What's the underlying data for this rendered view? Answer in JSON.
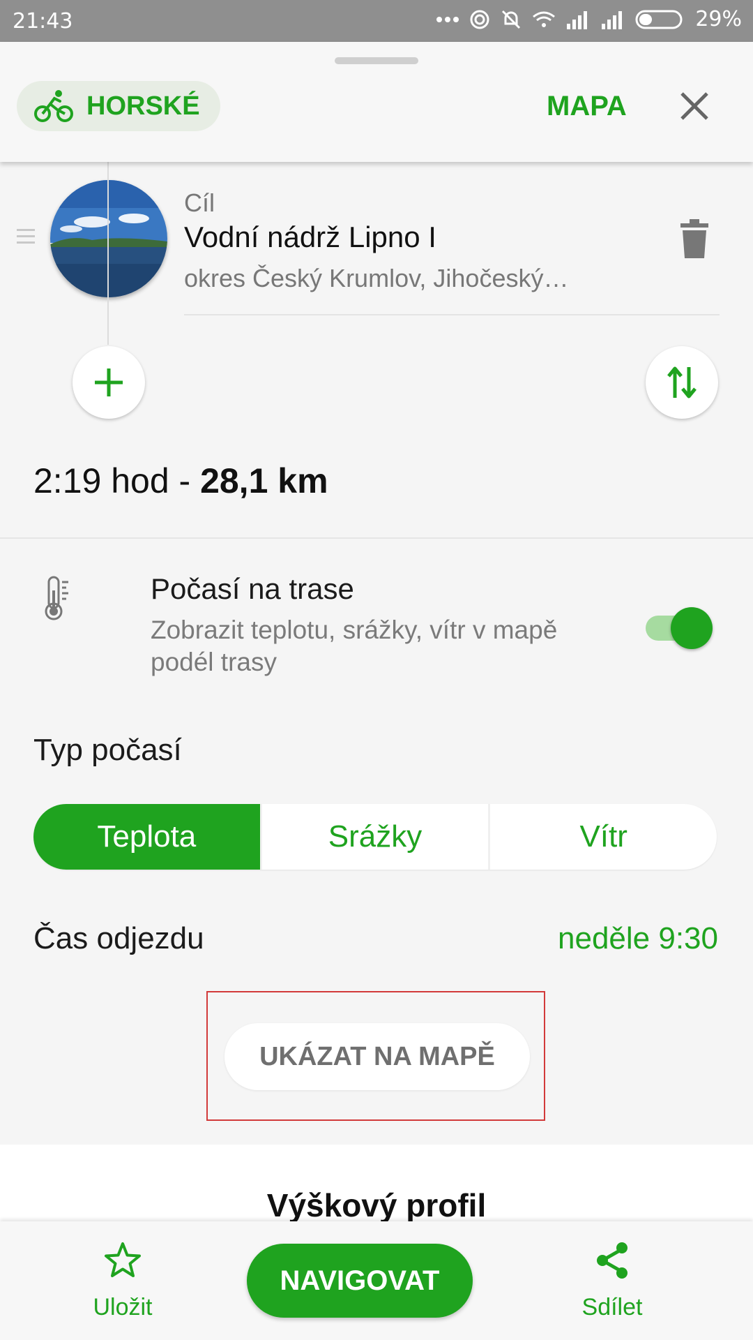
{
  "status_bar": {
    "time": "21:43",
    "battery": "29%",
    "icons": [
      "dots-icon",
      "hotspot-icon",
      "mute-icon",
      "wifi-icon",
      "signal-icon",
      "signal-icon",
      "battery-icon"
    ]
  },
  "header": {
    "profile_label": "HORSKÉ",
    "profile_icon": "bicycle-icon",
    "map_label": "MAPA",
    "close_icon": "close-icon"
  },
  "waypoint": {
    "kind": "Cíl",
    "name": "Vodní nádrž Lipno I",
    "address": "okres Český Krumlov, Jihočeský…"
  },
  "summary": {
    "duration": "2:19 hod - ",
    "distance": "28,1 km"
  },
  "weather": {
    "title": "Počasí na trase",
    "subtitle": "Zobrazit teplotu, srážky, vítr v mapě podél trasy",
    "enabled": true,
    "type_label": "Typ počasí",
    "options": [
      "Teplota",
      "Srážky",
      "Vítr"
    ],
    "selected": "Teplota"
  },
  "departure": {
    "label": "Čas odjezdu",
    "value": "neděle 9:30"
  },
  "show_map_label": "UKÁZAT NA MAPĚ",
  "elevation_title": "Výškový profil",
  "bottom": {
    "save_label": "Uložit",
    "navigate_label": "NAVIGOVAT",
    "share_label": "Sdílet"
  },
  "colors": {
    "accent": "#1fa31f",
    "highlight_border": "#d23a3a"
  }
}
